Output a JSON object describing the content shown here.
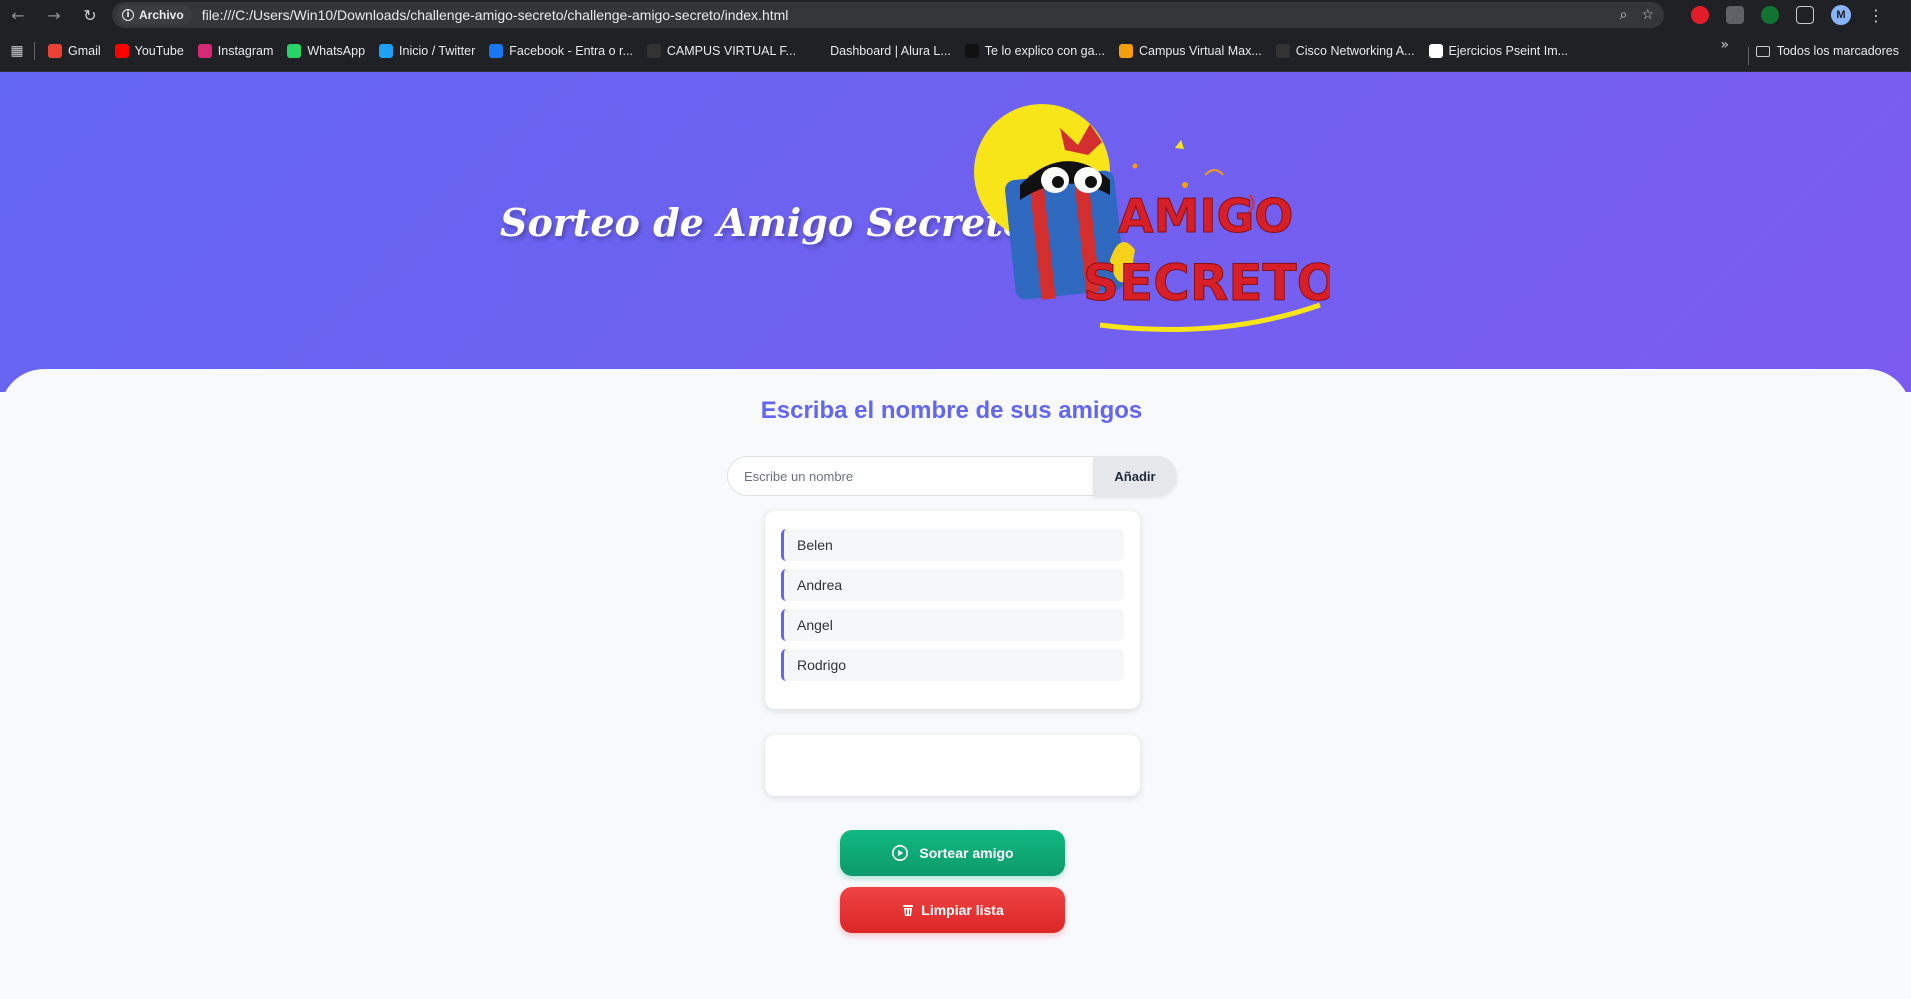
{
  "browser": {
    "info_chip": "Archivo",
    "url": "file:///C:/Users/Win10/Downloads/challenge-amigo-secreto/challenge-amigo-secreto/index.html",
    "avatar_letter": "M",
    "bookmarks": [
      {
        "label": "Gmail",
        "icon": "gmail-icon",
        "color": "#ea4335"
      },
      {
        "label": "YouTube",
        "icon": "youtube-icon",
        "color": "#ff0000"
      },
      {
        "label": "Instagram",
        "icon": "instagram-icon",
        "color": "#d62976"
      },
      {
        "label": "WhatsApp",
        "icon": "whatsapp-icon",
        "color": "#25d366"
      },
      {
        "label": "Inicio / Twitter",
        "icon": "twitter-icon",
        "color": "#1da1f2"
      },
      {
        "label": "Facebook - Entra o r...",
        "icon": "facebook-icon",
        "color": "#1877f2"
      },
      {
        "label": "CAMPUS VIRTUAL F...",
        "icon": "campus-icon",
        "color": "#333333"
      },
      {
        "label": "Dashboard | Alura L...",
        "icon": "alura-icon",
        "color": "#202124"
      },
      {
        "label": "Te lo explico con ga...",
        "icon": "video-icon",
        "color": "#111111"
      },
      {
        "label": "Campus Virtual Max...",
        "icon": "max-icon",
        "color": "#f59e0b"
      },
      {
        "label": "Cisco Networking A...",
        "icon": "cisco-icon",
        "color": "#333333"
      },
      {
        "label": "Ejercicios Pseint Im...",
        "icon": "pseint-icon",
        "color": "#ffffff"
      }
    ],
    "all_bookmarks": "Todos los marcadores"
  },
  "header": {
    "title": "Sorteo de Amigo Secreto",
    "image_word_1": "AMIGO",
    "image_word_2": "SECRETO"
  },
  "main": {
    "subtitle": "Escriba el nombre de sus amigos",
    "input_placeholder": "Escribe un nombre",
    "input_value": "",
    "add_button": "Añadir",
    "friends": [
      "Belen",
      "Andrea",
      "Angel",
      "Rodrigo"
    ],
    "result": "",
    "draw_button": "Sortear amigo",
    "clear_button": "Limpiar lista"
  },
  "colors": {
    "header_gradient_start": "#6366f1",
    "header_gradient_end": "#7c5cf0",
    "accent": "#6366f1",
    "draw_button": "#10b981",
    "clear_button": "#ef4444"
  }
}
